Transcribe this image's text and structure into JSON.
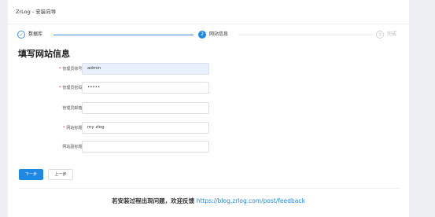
{
  "header": {
    "title": "ZrLog - 安装向导"
  },
  "steps": [
    {
      "label": "数据库",
      "status": "done",
      "icon": "check-icon"
    },
    {
      "label": "网站信息",
      "status": "active",
      "number": "2"
    },
    {
      "label": "完成",
      "status": "wait",
      "number": "3"
    }
  ],
  "form": {
    "title": "填写网站信息",
    "fields": [
      {
        "label": "管理员账号:",
        "required": true,
        "value": "admin"
      },
      {
        "label": "管理员密码:",
        "required": true,
        "value": "•••••"
      },
      {
        "label": "管理员邮箱:",
        "required": false,
        "value": ""
      },
      {
        "label": "网站标题:",
        "required": true,
        "value": "my zlog"
      },
      {
        "label": "网站副标题:",
        "required": false,
        "value": ""
      }
    ]
  },
  "buttons": {
    "next": "下一步",
    "prev": "上一步"
  },
  "footer": {
    "text": "若安装过程出现问题，欢迎反馈",
    "link": "https://blog.zrlog.com/post/feedback"
  },
  "colors": {
    "accent": "#1e88e5",
    "required": "#e33333"
  }
}
